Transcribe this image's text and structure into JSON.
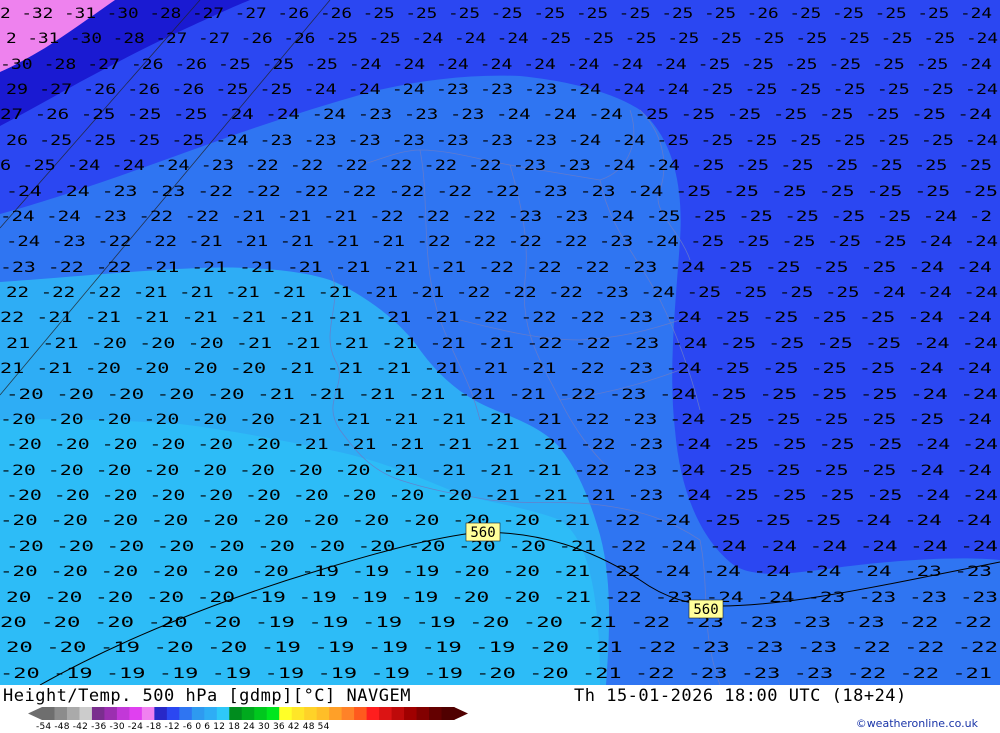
{
  "map": {
    "contour_label": "560",
    "zones": [
      {
        "name": "le-32",
        "color": "#ee82ee"
      },
      {
        "name": "m30",
        "color": "#1a1ad2"
      },
      {
        "name": "m27",
        "color": "#2b47f2"
      },
      {
        "name": "m24",
        "color": "#2f75f2"
      },
      {
        "name": "m21",
        "color": "#2eadf5"
      },
      {
        "name": "m18",
        "color": "#2ec8f8"
      }
    ],
    "rows": [
      "2 -32 -31 -30 -28 -27 -27 -26 -26 -25 -25 -25 -25 -25 -25 -25 -25 -25 -26 -25 -25 -25 -25 -24",
      "2 -31 -30 -28 -27 -27 -26 -26 -25 -25 -24 -24 -24 -25 -25 -25 -25 -25 -25 -25 -25 -25 -25 -24",
      "-30 -28 -27 -26 -26 -25 -25 -25 -24 -24 -24 -24 -24 -24 -24 -24 -25 -25 -25 -25 -25 -25 -24",
      "29 -27 -26 -26 -26 -25 -25 -24 -24 -24 -23 -23 -23 -24 -24 -24 -25 -25 -25 -25 -25 -25 -24",
      "27 -26 -25 -25 -25 -24 -24 -24 -23 -23 -23 -24 -24 -24 -25 -25 -25 -25 -25 -25 -25 -24",
      "26 -25 -25 -25 -25 -24 -23 -23 -23 -23 -23 -23 -23 -24 -24 -25 -25 -25 -25 -25 -25 -25 -24",
      "6 -25 -24 -24 -24 -23 -22 -22 -22 -22 -22 -22 -23 -23 -24 -24 -25 -25 -25 -25 -25 -25 -25",
      "-24 -24 -23 -23 -22 -22 -22 -22 -22 -22 -22 -23 -23 -24 -25 -25 -25 -25 -25 -25 -25",
      "-24 -24 -23 -22 -22 -21 -21 -21 -22 -22 -22 -23 -23 -24 -25 -25 -25 -25 -25 -25 -24 -2",
      "-24 -23 -22 -22 -21 -21 -21 -21 -21 -22 -22 -22 -22 -23 -24 -25 -25 -25 -25 -25 -24 -24",
      "-23 -22 -22 -21 -21 -21 -21 -21 -21 -21 -22 -22 -22 -23 -24 -25 -25 -25 -25 -24 -24",
      "22 -22 -22 -21 -21 -21 -21 -21 -21 -21 -22 -22 -22 -23 -24 -25 -25 -25 -25 -24 -24 -24",
      "22 -21 -21 -21 -21 -21 -21 -21 -21 -21 -22 -22 -22 -23 -24 -25 -25 -25 -25 -24 -24",
      "21 -21 -20 -20 -20 -21 -21 -21 -21 -21 -21 -22 -22 -23 -24 -25 -25 -25 -25 -24 -24",
      "21 -21 -20 -20 -20 -20 -21 -21 -21 -21 -21 -21 -22 -23 -24 -25 -25 -25 -25 -24 -24",
      "-20 -20 -20 -20 -20 -21 -21 -21 -21 -21 -21 -22 -23 -24 -25 -25 -25 -25 -24 -24",
      "-20 -20 -20 -20 -20 -20 -21 -21 -21 -21 -21 -21 -22 -23 -24 -25 -25 -25 -25 -25 -24",
      "-20 -20 -20 -20 -20 -20 -21 -21 -21 -21 -21 -21 -22 -23 -24 -25 -25 -25 -25 -24 -24",
      "-20 -20 -20 -20 -20 -20 -20 -20 -21 -21 -21 -21 -22 -23 -24 -25 -25 -25 -25 -24 -24",
      "-20 -20 -20 -20 -20 -20 -20 -20 -20 -20 -21 -21 -21 -23 -24 -25 -25 -25 -25 -24 -24",
      "-20 -20 -20 -20 -20 -20 -20 -20 -20 -20 -20 -21 -22 -24 -25 -25 -25 -24 -24 -24",
      "-20 -20 -20 -20 -20 -20 -20 -20 -20 -20 -20 -21 -22 -24 -24 -24 -24 -24 -24 -24",
      "-20 -20 -20 -20 -20 -20 -19 -19 -19 -20 -20 -21 -22 -24 -24 -24 -24 -24 -23 -23",
      "20 -20 -20 -20 -20 -19 -19 -19 -19 -20 -20 -21 -22 -23 -24 -24 -23 -23 -23 -23",
      "20 -20 -20 -20 -20 -19 -19 -19 -19 -20 -20 -21 -22 -23 -23 -23 -23 -22 -22",
      "20 -20 -19 -20 -20 -19 -19 -19 -19 -19 -20 -21 -22 -23 -23 -23 -22 -22 -22",
      "-20 -19 -19 -19 -19 -19 -19 -19 -19 -20 -20 -21 -22 -23 -23 -23 -22 -22 -21"
    ]
  },
  "footer": {
    "title": "Height/Temp. 500 hPa [gdmp][°C] NAVGEM",
    "timestamp": "Th 15-01-2026 18:00 UTC (18+24)",
    "credit": "©weatheronline.co.uk",
    "scale_ticks": "-54 -48 -42 -36 -30 -24 -18 -12 -6  0  6  12  18  24  30  36  42  48  54",
    "scale_colors": [
      "#6e6e6e",
      "#8c8c8c",
      "#aaaaaa",
      "#cccccc",
      "#7a2e8e",
      "#9b2fb0",
      "#c238d8",
      "#e040f0",
      "#f080f0",
      "#2828c8",
      "#2b47f2",
      "#2f75f2",
      "#2e9af0",
      "#2eadf5",
      "#2ec8f8",
      "#008c1e",
      "#00aa1e",
      "#00c81e",
      "#00e61e",
      "#ffff28",
      "#ffe628",
      "#ffd228",
      "#ffbe28",
      "#ffa028",
      "#ff8228",
      "#ff5a1e",
      "#ff1e1e",
      "#dc1414",
      "#be0a0a",
      "#a00000",
      "#820000",
      "#640000",
      "#500000"
    ]
  }
}
